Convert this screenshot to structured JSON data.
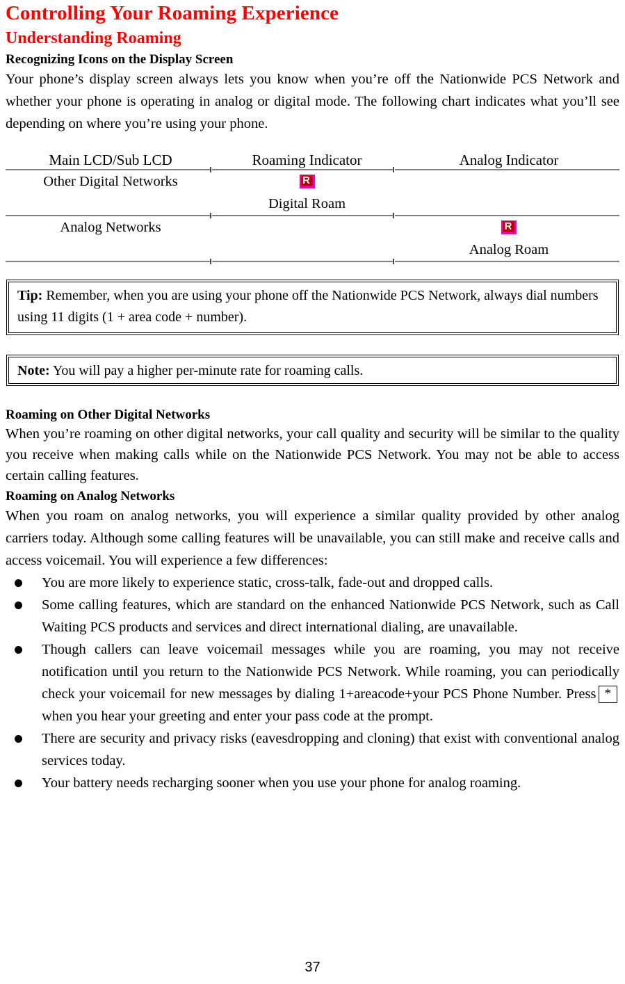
{
  "document": {
    "title": "Controlling Your Roaming Experience",
    "page_number": "37"
  },
  "sections": {
    "understanding_roaming": {
      "heading": "Understanding Roaming",
      "subheading": "Recognizing Icons on the Display Screen",
      "paragraph": "Your phone’s display screen always lets you know when you’re off the Nationwide PCS Network and whether your phone is operating in analog or digital mode. The following chart indicates what you’ll see depending on where you’re using your phone."
    },
    "roaming_other_digital": {
      "heading": "Roaming on Other Digital Networks",
      "paragraph": "When you’re roaming on other digital networks, your call quality and security will be similar to the quality you receive when making calls while on the Nationwide PCS Network. You may not be able to access certain calling features."
    },
    "roaming_analog": {
      "heading": "Roaming on Analog Networks",
      "paragraph": "When you roam on analog networks, you will experience a similar quality provided by other analog carriers today. Although some calling features will be unavailable, you can still make and receive calls and access voicemail. You will experience a few differences:",
      "bullets": [
        {
          "text": "You are more likely to experience static, cross-talk, fade-out and dropped calls."
        },
        {
          "text": "Some calling features, which are standard on the enhanced Nationwide PCS Network, such as Call Waiting PCS products and services and direct international dialing, are unavailable."
        },
        {
          "text_before_key": "Though callers can leave voicemail messages while you are roaming, you may not receive notification until you return to the Nationwide PCS Network.  While roaming, you can periodically check your voicemail for new messages by dialing 1+areacode+your PCS Phone Number.   Press",
          "key_label": "*",
          "text_after_key": "when you hear your greeting and enter your pass code at the prompt."
        },
        {
          "text": "There are security and privacy risks (eavesdropping and cloning) that exist with conventional analog services today."
        },
        {
          "text": "Your battery needs recharging sooner when you use your phone for analog roaming."
        }
      ]
    }
  },
  "indicator_table": {
    "headers": [
      "Main LCD/Sub LCD",
      "Roaming Indicator",
      "Analog Indicator"
    ],
    "rows": [
      {
        "network": "Other Digital Networks",
        "roaming_icon": "roaming-r-icon",
        "roaming_caption": "Digital Roam",
        "analog_icon": null,
        "analog_caption": ""
      },
      {
        "network": "Analog Networks",
        "roaming_icon": null,
        "roaming_caption": "",
        "analog_icon": "roaming-r-icon",
        "analog_caption": "Analog Roam"
      }
    ]
  },
  "callouts": {
    "tip": {
      "label": "Tip:",
      "text": " Remember, when you are using your phone off the Nationwide PCS Network, always dial numbers using 11 digits (1 + area code + number)."
    },
    "note": {
      "label": "Note:",
      "text": " You will pay a higher per-minute rate for roaming calls."
    }
  },
  "colors": {
    "heading_red": "#ff0000",
    "rule_gray": "#808080",
    "icon_magenta": "#f000c0",
    "icon_red": "#c00000",
    "text_black": "#000000"
  }
}
